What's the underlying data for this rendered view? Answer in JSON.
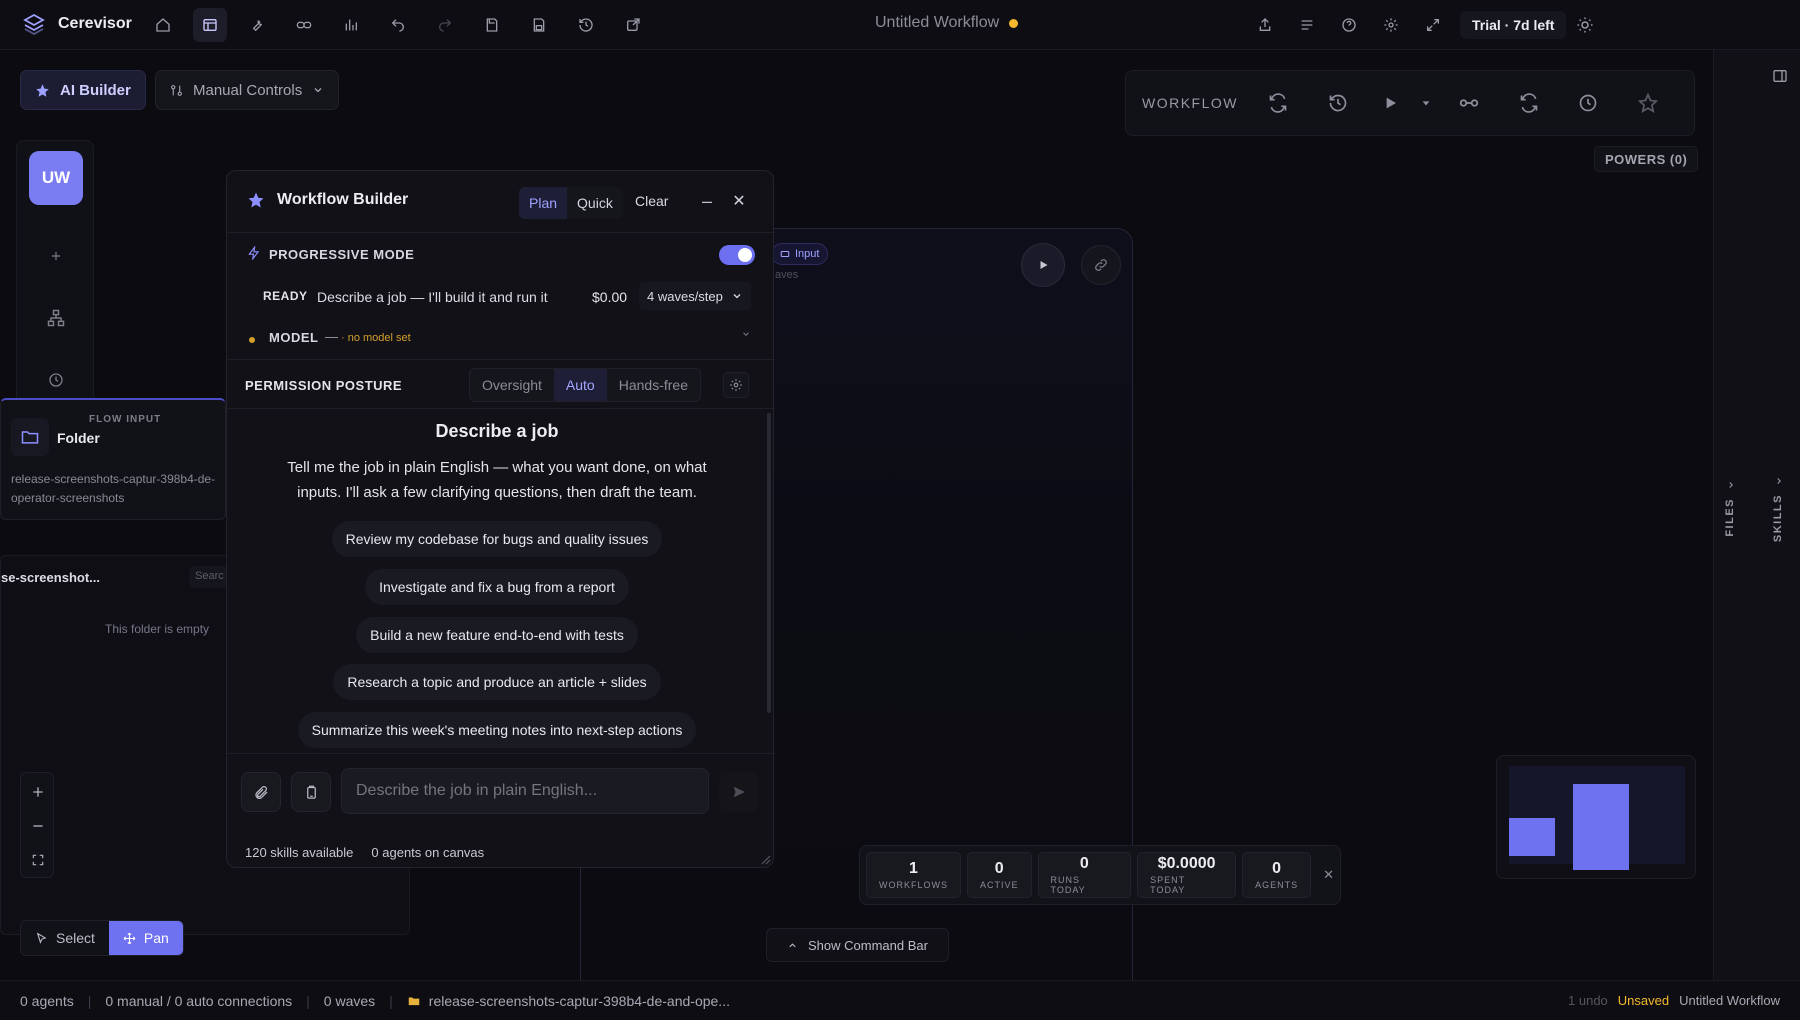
{
  "app": {
    "name": "Cerevisor",
    "workflow_title": "Untitled Workflow",
    "trial": "Trial · 7d left"
  },
  "top_icons": [
    "home-icon",
    "layout-icon",
    "wrench-icon",
    "link-icon",
    "chart-icon",
    "undo-icon",
    "redo-icon",
    "save-icon",
    "save-as-icon",
    "history-icon",
    "export-icon"
  ],
  "top_right_icons": [
    "share-icon",
    "list-icon",
    "help-icon",
    "settings-icon",
    "expand-icon",
    "sun-icon"
  ],
  "builder_toggle": {
    "ai_builder": "AI Builder",
    "manual_controls": "Manual Controls"
  },
  "rail": {
    "avatar": "UW"
  },
  "input_card": {
    "label": "FLOW INPUT",
    "name": "Folder",
    "path": "release-screenshots-captur-398b4-de-operator-screenshots"
  },
  "file_pane": {
    "title": "se-screenshot...",
    "search": "Searc",
    "empty": "This folder is empty"
  },
  "tools": {
    "select": "Select",
    "pan": "Pan"
  },
  "canvas_node": {
    "chip": "Input",
    "sub": "aves"
  },
  "toolbar": {
    "label": "WORKFLOW",
    "powers": "POWERS (0)"
  },
  "side_panels": {
    "files": "FILES",
    "skills": "SKILLS"
  },
  "builder": {
    "title": "Workflow Builder",
    "tabs": [
      "Plan",
      "Quick"
    ],
    "clear": "Clear",
    "minimize": "–",
    "close": "✕",
    "progressive": "PROGRESSIVE MODE",
    "ready": "READY",
    "ready_text": "Describe a job — I'll build it and run it",
    "cost": "$0.00",
    "waves": "4 waves/step",
    "model_label": "MODEL",
    "model_dash": "—",
    "model_note": "· no model set",
    "permission": "PERMISSION POSTURE",
    "perm_tabs": [
      "Oversight",
      "Auto",
      "Hands-free"
    ],
    "describe_title": "Describe a job",
    "describe_body": "Tell me the job in plain English — what you want done, on what inputs. I'll ask a few clarifying questions, then draft the team.",
    "suggestions": [
      "Review my codebase for bugs and quality issues",
      "Investigate and fix a bug from a report",
      "Build a new feature end-to-end with tests",
      "Research a topic and produce an article + slides",
      "Summarize this week's meeting notes into next-step actions"
    ],
    "placeholder": "Describe the job in plain English...",
    "skills": "120 skills available",
    "agents": "0 agents on canvas"
  },
  "stats": [
    {
      "value": "1",
      "label": "WORKFLOWS"
    },
    {
      "value": "0",
      "label": "ACTIVE"
    },
    {
      "value": "0",
      "label": "RUNS TODAY"
    },
    {
      "value": "$0.0000",
      "label": "SPENT TODAY"
    },
    {
      "value": "0",
      "label": "AGENTS"
    }
  ],
  "command_bar": "Show Command Bar",
  "statusbar": {
    "agents": "0 agents",
    "connections": "0 manual / 0 auto connections",
    "waves": "0 waves",
    "folder": "release-screenshots-captur-398b4-de-and-ope...",
    "undo": "1 undo",
    "unsaved": "Unsaved",
    "workflow": "Untitled Workflow"
  },
  "colors": {
    "accent": "#6f72f0",
    "warning": "#f5b82e"
  }
}
